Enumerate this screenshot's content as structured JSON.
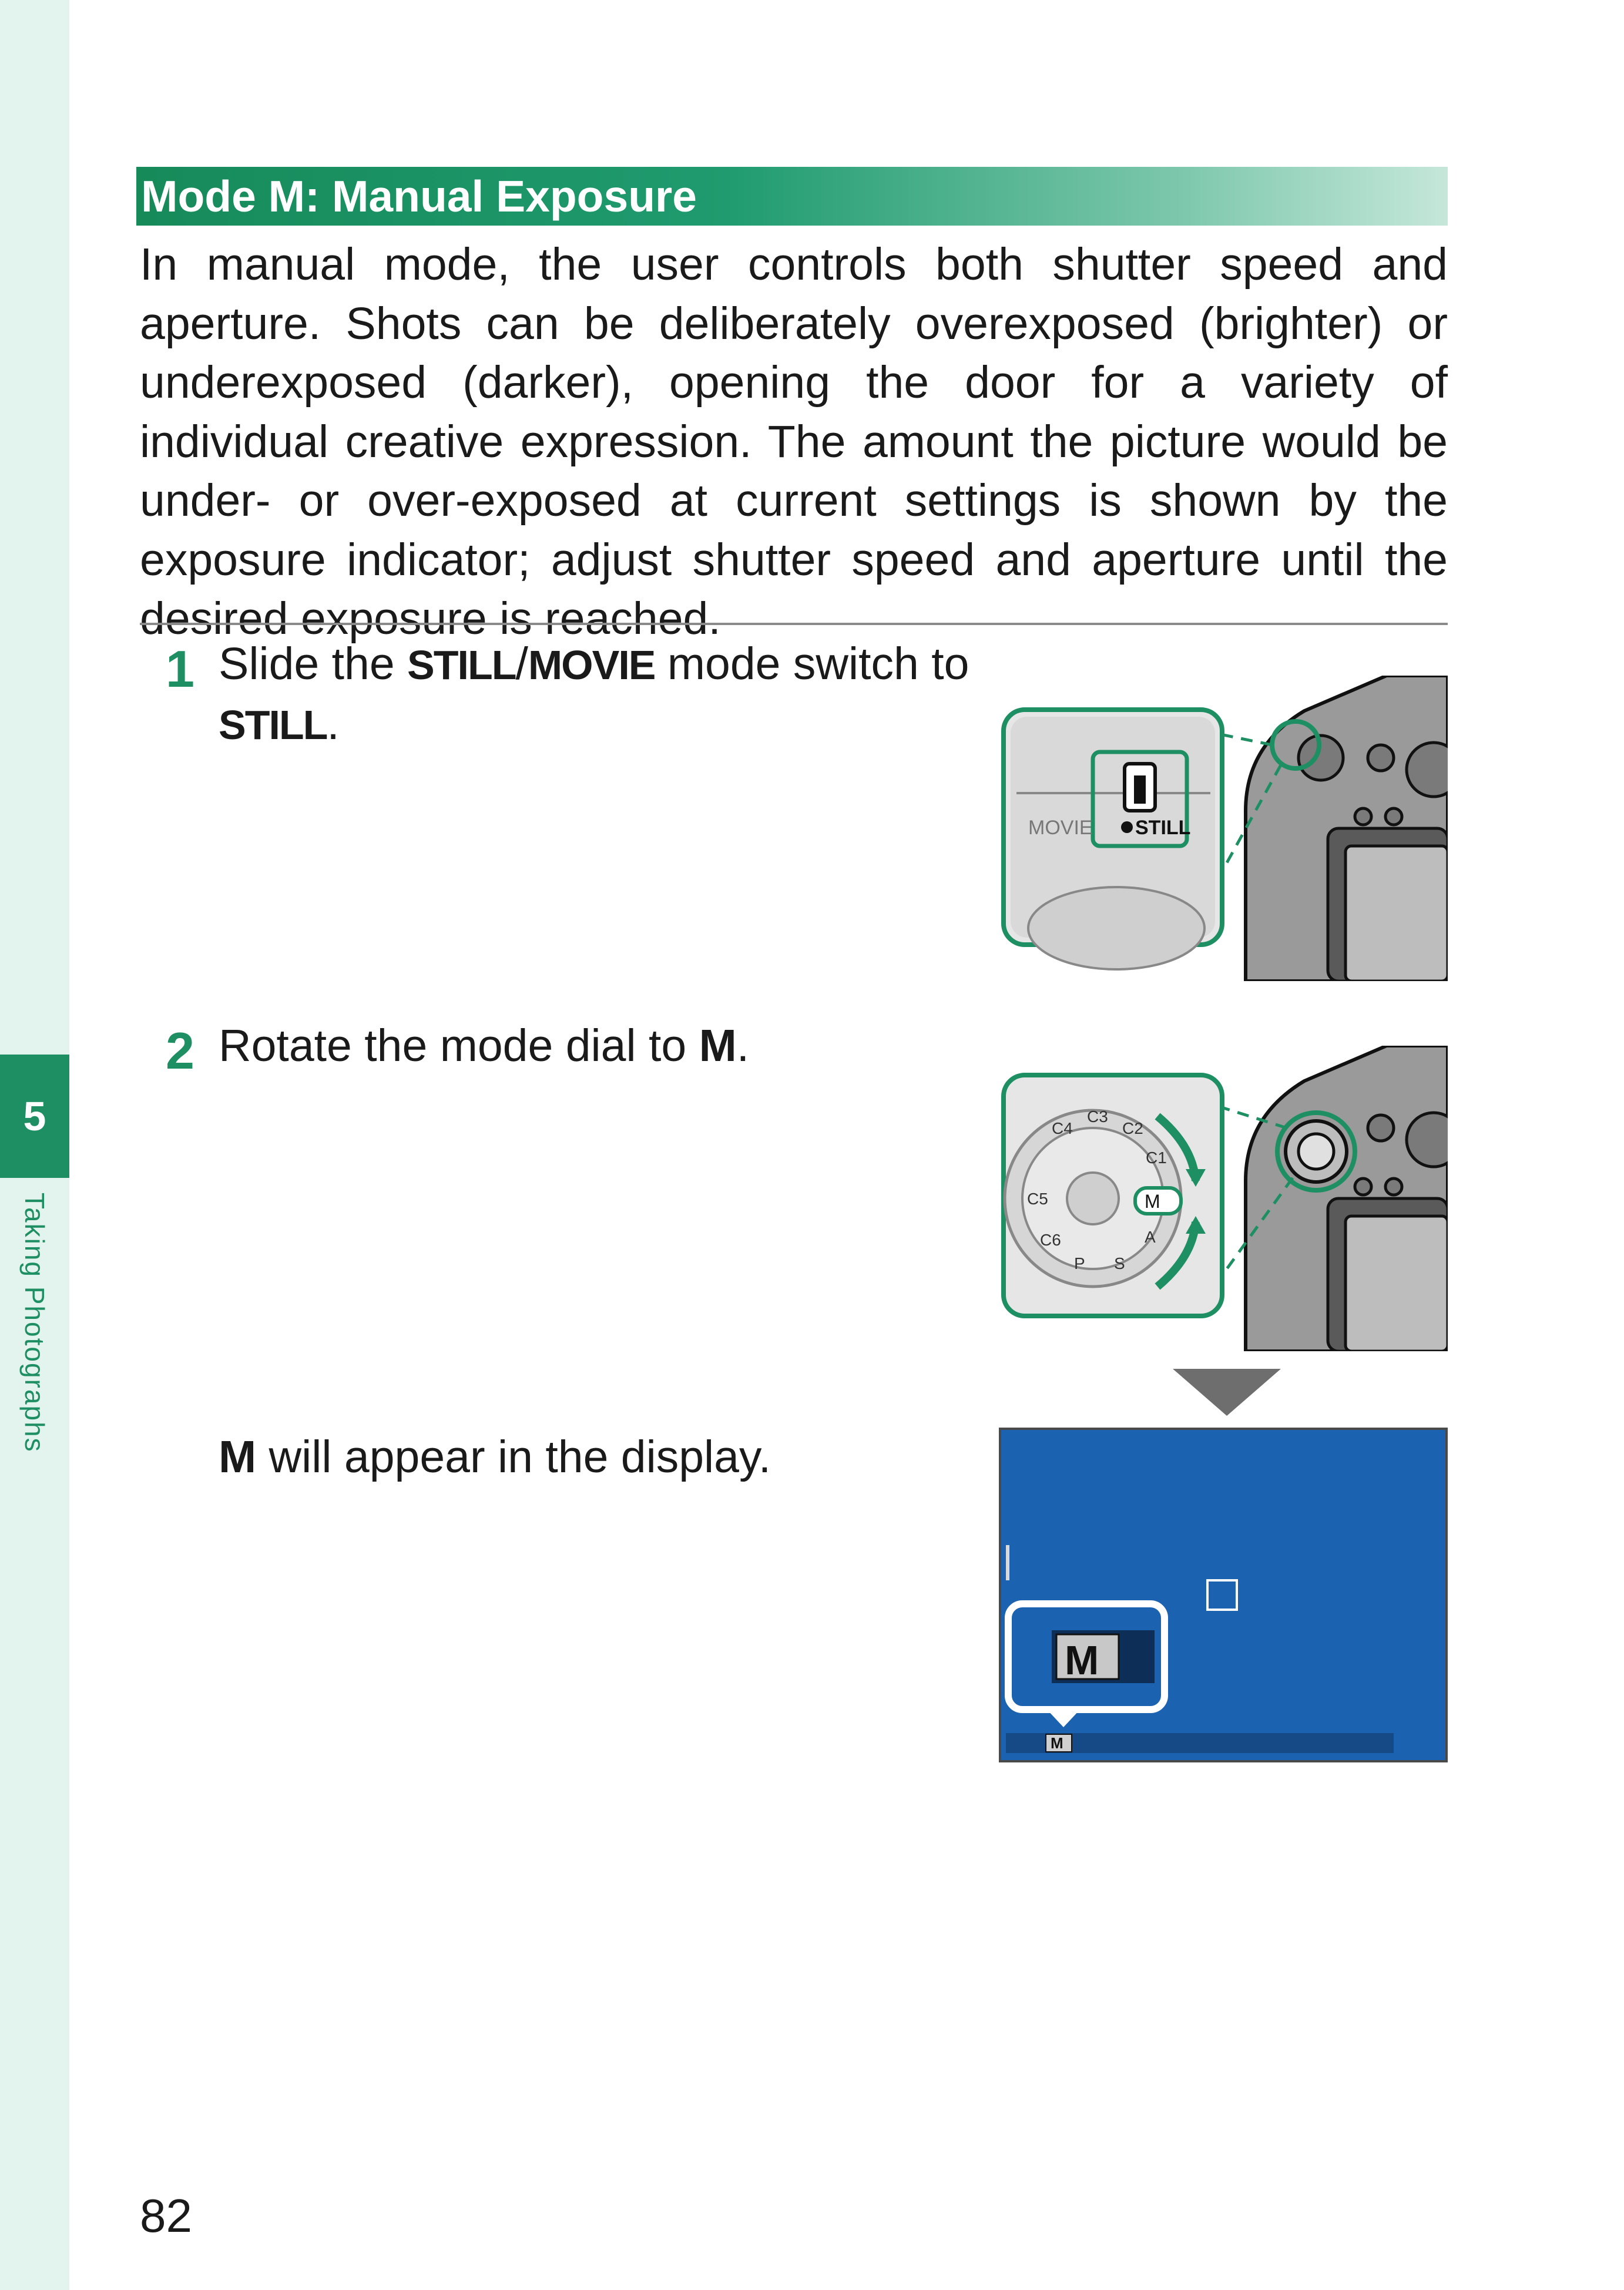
{
  "chapter": {
    "number": "5",
    "label": "Taking Photographs"
  },
  "section": {
    "title": "Mode M: Manual Exposure"
  },
  "intro": "In manual mode, the user controls both shutter speed and aperture. Shots can be deliberately overexposed (brighter) or underexposed (darker), opening the door for a variety of individual creative expression. The amount the picture would be under- or over-exposed at current settings is shown by the exposure indicator; adjust shutter speed and aperture until the desired exposure is reached.",
  "steps": [
    {
      "number": "1",
      "text_before": "Slide the ",
      "switch_a": "STILL",
      "slash": "/",
      "switch_b": "MOVIE",
      "text_middle": " mode switch to ",
      "target": "STILL",
      "text_after": "."
    },
    {
      "number": "2",
      "text_before": "Rotate the mode dial to ",
      "target": "M",
      "text_after": ".",
      "result_mark": "M",
      "result_text": " will appear in the display."
    }
  ],
  "illustrations": {
    "switch_labels": {
      "movie": "MOVIE",
      "still": "STILL"
    },
    "dial_labels": [
      "C1",
      "C2",
      "C3",
      "C4",
      "C5",
      "C6",
      "P",
      "S",
      "A",
      "M"
    ],
    "display": {
      "mode_big": "M",
      "mode_small": "M",
      "bg_color": "#1b62b0"
    }
  },
  "colors": {
    "accent": "#1d8f63",
    "heading_from": "#178a5a",
    "heading_to": "#c5e7da"
  },
  "page_number": "82"
}
